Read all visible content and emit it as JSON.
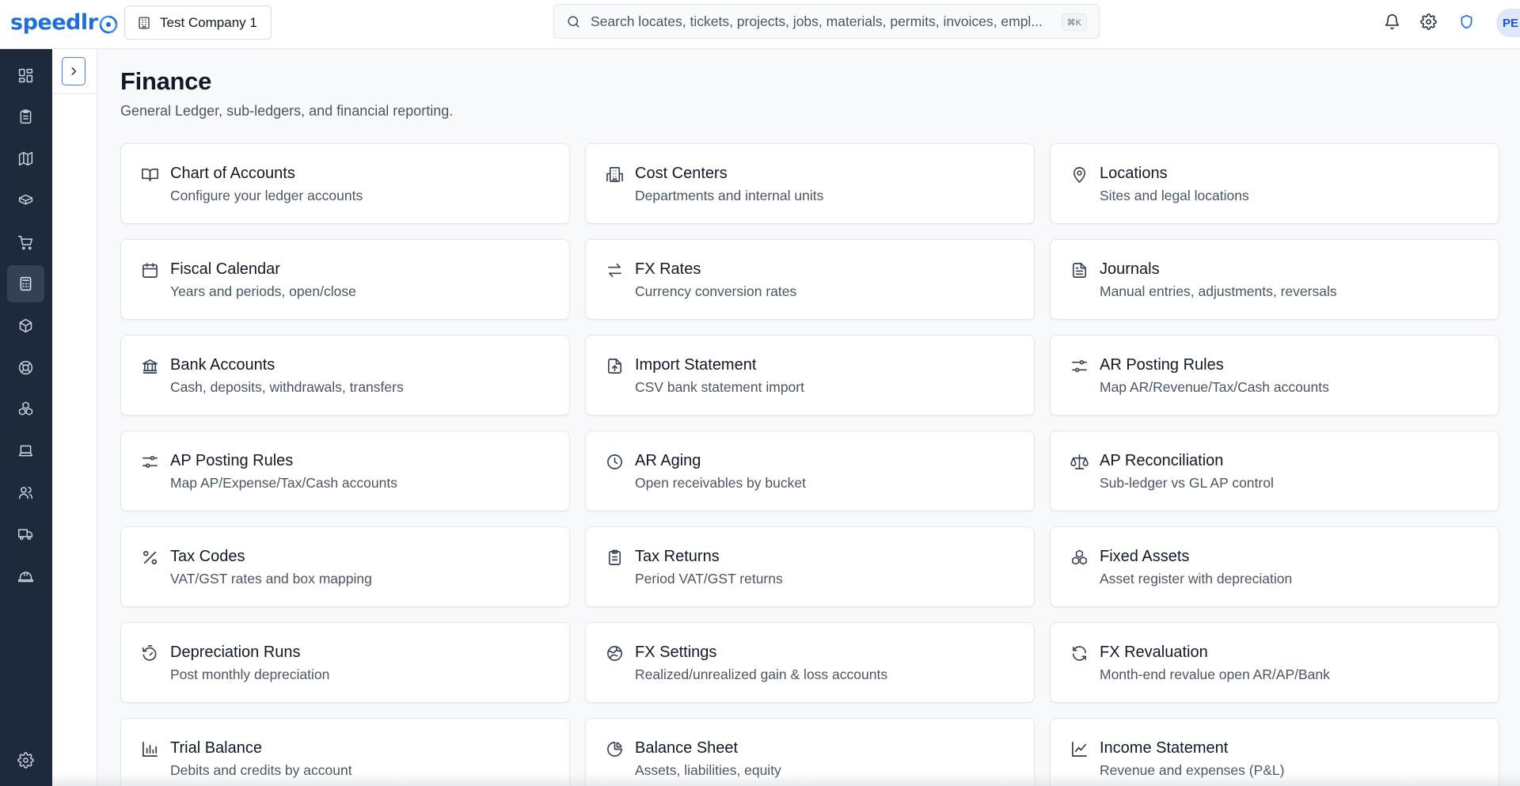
{
  "app": {
    "logo_text": "speedlr",
    "company": "Test Company 1",
    "search": {
      "placeholder": "Search locates, tickets, projects, jobs, materials, permits, invoices, empl...",
      "shortcut": "⌘K"
    },
    "header_icons": [
      "bell-icon",
      "gear-icon",
      "shield-icon"
    ],
    "avatar_initials": "PE"
  },
  "rail": {
    "items": [
      {
        "icon": "dashboard-icon"
      },
      {
        "icon": "clipboard-icon"
      },
      {
        "icon": "map-icon"
      },
      {
        "icon": "ticket-icon"
      },
      {
        "icon": "cart-icon"
      },
      {
        "icon": "calculator-icon",
        "active": true
      },
      {
        "icon": "package-icon"
      },
      {
        "icon": "lifebuoy-icon"
      },
      {
        "icon": "boxes-icon"
      },
      {
        "icon": "laptop-icon"
      },
      {
        "icon": "users-icon"
      },
      {
        "icon": "truck-icon"
      },
      {
        "icon": "hard-hat-icon"
      }
    ],
    "bottom_icon": "gear-icon"
  },
  "page": {
    "title": "Finance",
    "subtitle": "General Ledger, sub-ledgers, and financial reporting."
  },
  "cards": [
    {
      "icon": "book-icon",
      "title": "Chart of Accounts",
      "desc": "Configure your ledger accounts"
    },
    {
      "icon": "building-icon",
      "title": "Cost Centers",
      "desc": "Departments and internal units"
    },
    {
      "icon": "map-pin-icon",
      "title": "Locations",
      "desc": "Sites and legal locations"
    },
    {
      "icon": "calendar-icon",
      "title": "Fiscal Calendar",
      "desc": "Years and periods, open/close"
    },
    {
      "icon": "arrows-exchange-icon",
      "title": "FX Rates",
      "desc": "Currency conversion rates"
    },
    {
      "icon": "file-text-icon",
      "title": "Journals",
      "desc": "Manual entries, adjustments, reversals"
    },
    {
      "icon": "bank-icon",
      "title": "Bank Accounts",
      "desc": "Cash, deposits, withdrawals, transfers"
    },
    {
      "icon": "file-upload-icon",
      "title": "Import Statement",
      "desc": "CSV bank statement import"
    },
    {
      "icon": "sliders-icon",
      "title": "AR Posting Rules",
      "desc": "Map AR/Revenue/Tax/Cash accounts"
    },
    {
      "icon": "sliders-icon",
      "title": "AP Posting Rules",
      "desc": "Map AP/Expense/Tax/Cash accounts"
    },
    {
      "icon": "clock-icon",
      "title": "AR Aging",
      "desc": "Open receivables by bucket"
    },
    {
      "icon": "scale-icon",
      "title": "AP Reconciliation",
      "desc": "Sub-ledger vs GL AP control"
    },
    {
      "icon": "percent-icon",
      "title": "Tax Codes",
      "desc": "VAT/GST rates and box mapping"
    },
    {
      "icon": "clipboard-list-icon",
      "title": "Tax Returns",
      "desc": "Period VAT/GST returns"
    },
    {
      "icon": "boxes-icon",
      "title": "Fixed Assets",
      "desc": "Asset register with depreciation"
    },
    {
      "icon": "timer-reset-icon",
      "title": "Depreciation Runs",
      "desc": "Post monthly depreciation"
    },
    {
      "icon": "globe-icon",
      "title": "FX Settings",
      "desc": "Realized/unrealized gain & loss accounts"
    },
    {
      "icon": "refresh-icon",
      "title": "FX Revaluation",
      "desc": "Month-end revalue open AR/AP/Bank"
    },
    {
      "icon": "bar-chart-icon",
      "title": "Trial Balance",
      "desc": "Debits and credits by account"
    },
    {
      "icon": "pie-chart-icon",
      "title": "Balance Sheet",
      "desc": "Assets, liabilities, equity"
    },
    {
      "icon": "line-chart-icon",
      "title": "Income Statement",
      "desc": "Revenue and expenses (P&L)"
    }
  ],
  "colors": {
    "brand": "#1f6fd6",
    "rail_bg": "#1e293b",
    "rail_active": "#334155",
    "text_primary": "#111827",
    "text_secondary": "#4b5563"
  }
}
